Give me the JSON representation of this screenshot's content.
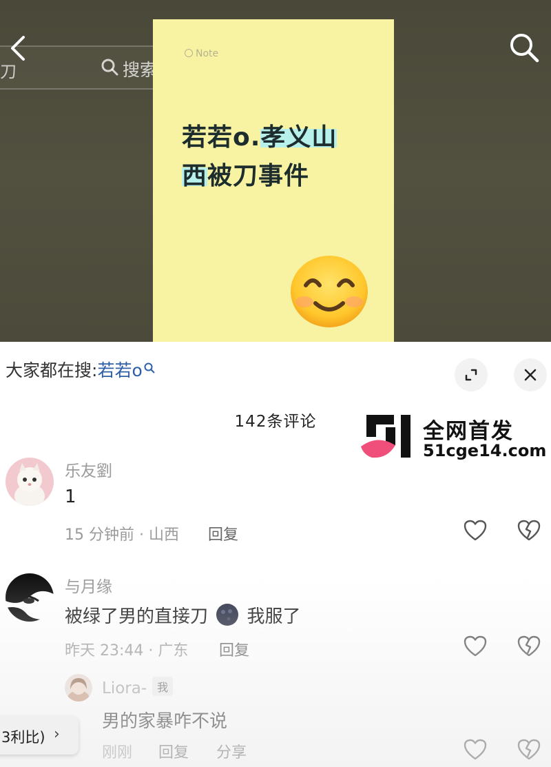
{
  "top_bar": {
    "search_query": "刀",
    "search_label": "搜索"
  },
  "note": {
    "brand": "Note",
    "title_part1": "若若o.",
    "title_part2": "孝义山",
    "title_part3": "西",
    "title_part4": "被刀事件",
    "emoji": "smiling-face-with-blush"
  },
  "sheet": {
    "search_prefix": "大家都在搜:",
    "search_keyword": "若若o",
    "comment_count": "142条评论"
  },
  "watermark": {
    "line1": "全网首发",
    "line2": "51cge14.com"
  },
  "comments": [
    {
      "user": "乐友劉",
      "text": "1",
      "meta": "15 分钟前 · 山西",
      "reply": "回复"
    },
    {
      "user": "与月缘",
      "text": "被绿了男的直接刀",
      "text_after": "我服了",
      "meta": "昨天 23:44 · 广东",
      "reply": "回复"
    },
    {
      "user": "Liora-",
      "badge": "我",
      "text": "男的家暴咋不说",
      "meta": "刚刚",
      "reply": "回复",
      "share": "分享"
    }
  ],
  "float_pill": {
    "text": "3利比)",
    "arrow": "›"
  },
  "colors": {
    "note_bg": "#f8f3a2",
    "highlight": "#b8f0ec",
    "keyword_blue": "#2c5fa8",
    "watermark_pink": "#ef4f7a"
  }
}
